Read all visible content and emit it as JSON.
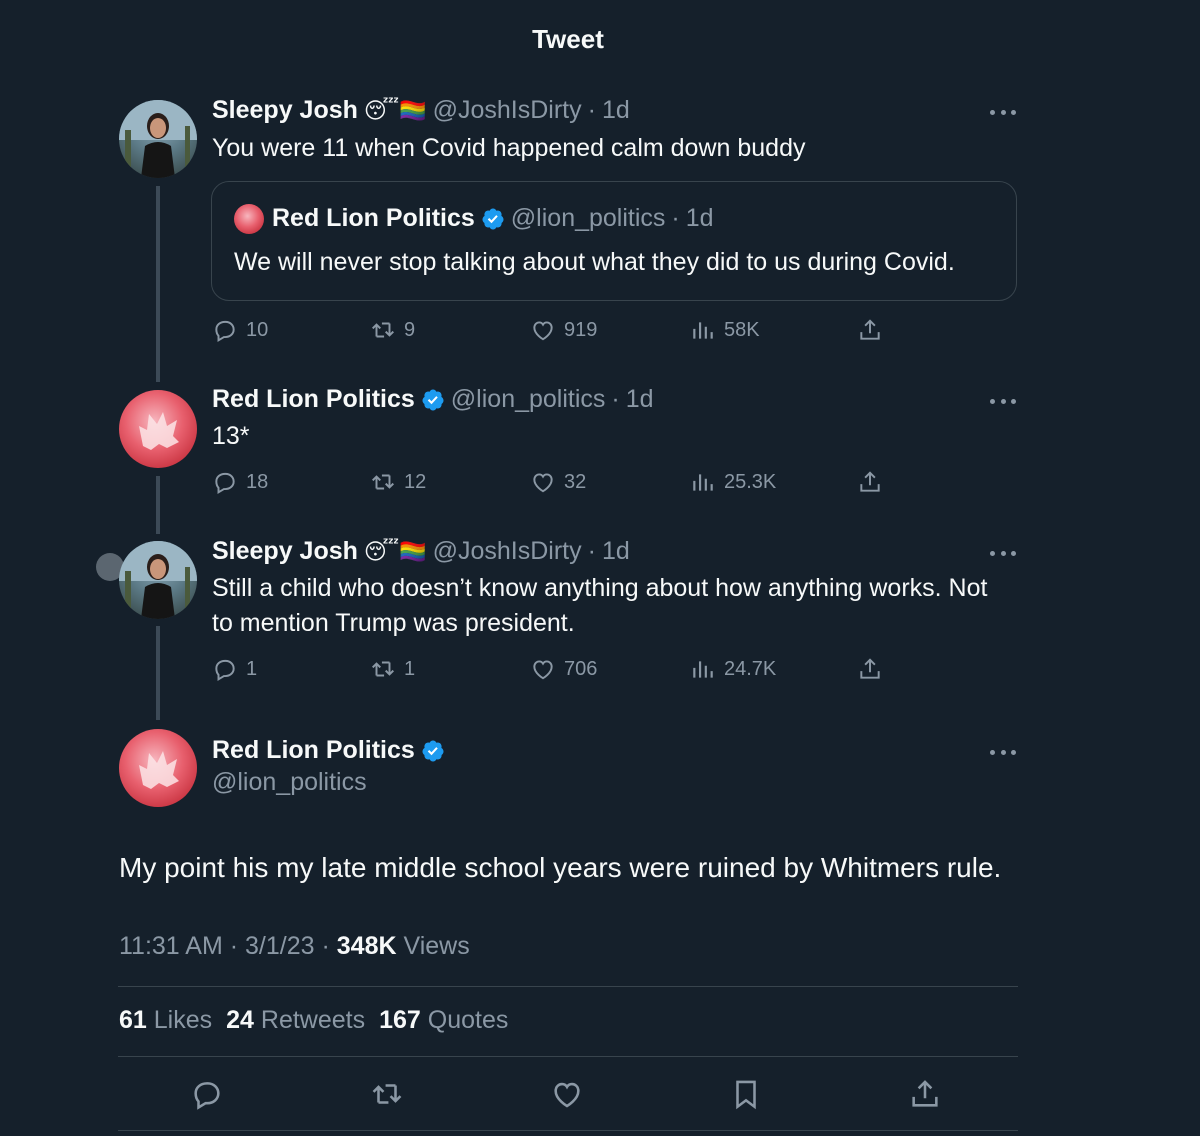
{
  "header": {
    "title": "Tweet"
  },
  "tweets": [
    {
      "name": "Sleepy Josh",
      "emoji": "😴🏳️‍🌈",
      "handle": "@JoshIsDirty",
      "time": "1d",
      "text": "You were 11 when Covid happened calm down buddy",
      "quote": {
        "name": "Red Lion Politics",
        "handle": "@lion_politics",
        "time": "1d",
        "text": "We will never stop talking about what they did to us during Covid."
      },
      "replies": "10",
      "retweets": "9",
      "likes": "919",
      "views": "58K"
    },
    {
      "name": "Red Lion Politics",
      "handle": "@lion_politics",
      "time": "1d",
      "text": "13*",
      "replies": "18",
      "retweets": "12",
      "likes": "32",
      "views": "25.3K"
    },
    {
      "name": "Sleepy Josh",
      "emoji": "😴🏳️‍🌈",
      "handle": "@JoshIsDirty",
      "time": "1d",
      "text": "Still a child who doesn’t know anything about how anything works. Not to mention Trump was president.",
      "replies": "1",
      "retweets": "1",
      "likes": "706",
      "views": "24.7K"
    }
  ],
  "main": {
    "name": "Red Lion Politics",
    "handle": "@lion_politics",
    "text": "My point his my late middle school years were ruined by Whitmers rule.",
    "time": "11:31 AM",
    "date": "3/1/23",
    "views_count": "348K",
    "views_label": "Views",
    "likes_count": "61",
    "likes_label": "Likes",
    "retweets_count": "24",
    "retweets_label": "Retweets",
    "quotes_count": "167",
    "quotes_label": "Quotes"
  },
  "colors": {
    "background": "#15202b",
    "muted": "#8b98a5",
    "verified": "#1d9bf0",
    "border": "#38444d"
  }
}
